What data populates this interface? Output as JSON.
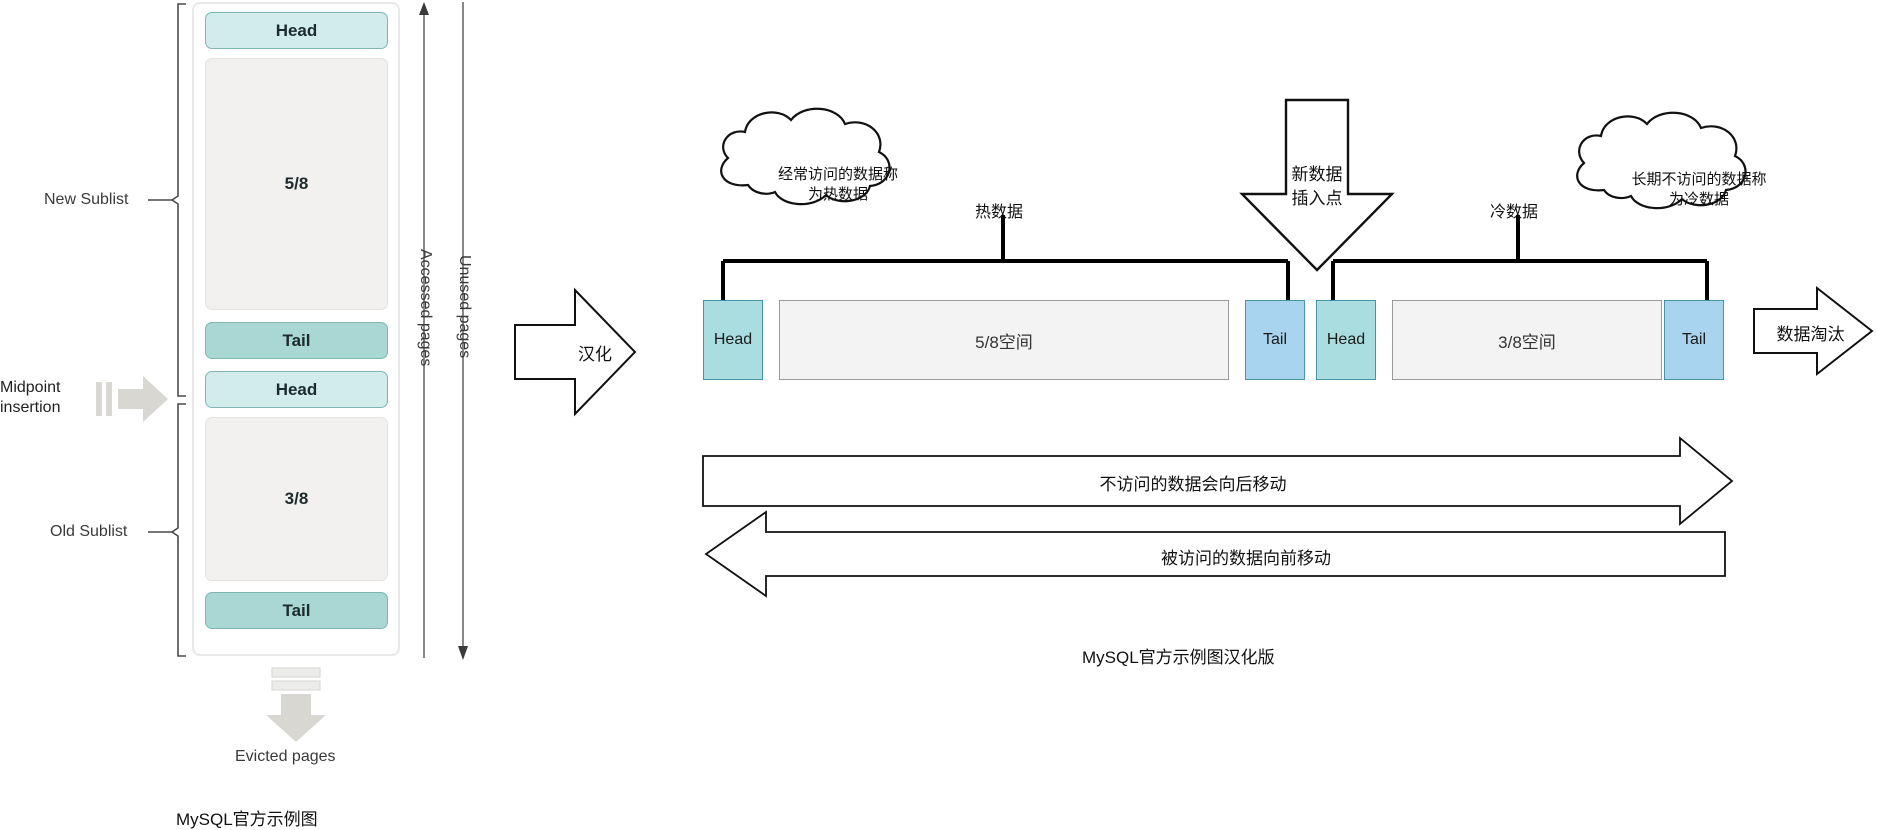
{
  "left_figure": {
    "title_caption": "MySQL官方示例图",
    "new_sublist_label": "New Sublist",
    "old_sublist_label": "Old Sublist",
    "midpoint_label_line1": "Midpoint",
    "midpoint_label_line2": "insertion",
    "accessed_pages_label": "Accessed pages",
    "unused_pages_label": "Unused pages",
    "evicted_pages_label": "Evicted pages",
    "blocks": [
      {
        "label": "Head",
        "kind": "head"
      },
      {
        "label": "5/8",
        "kind": "fraction"
      },
      {
        "label": "Tail",
        "kind": "tail"
      },
      {
        "label": "Head",
        "kind": "head"
      },
      {
        "label": "3/8",
        "kind": "fraction"
      },
      {
        "label": "Tail",
        "kind": "tail"
      }
    ],
    "colors": {
      "head_fill": "#d2ecec",
      "tail_fill": "#a9d8d4",
      "fraction_fill": "#f2f1ef",
      "panel_border": "#e8e8e8",
      "axis_stroke": "#6b6b6b",
      "big_arrow_fill": "#d9d7d2"
    }
  },
  "transition_arrow": {
    "label": "汉化"
  },
  "right_figure": {
    "caption": "MySQL官方示例图汉化版",
    "cloud_hot": "经常访问的数据称\n为热数据",
    "cloud_cold": "长期不访问的数据称\n为冷数据",
    "insert_arrow_line1": "新数据",
    "insert_arrow_line2": "插入点",
    "hot_data_label": "热数据",
    "cold_data_label": "冷数据",
    "evict_arrow_label": "数据淘汰",
    "backward_arrow_label": "不访问的数据会向后移动",
    "forward_arrow_label": "被访问的数据向前移动",
    "segments": [
      {
        "label": "Head",
        "kind": "head"
      },
      {
        "label": "5/8空间",
        "kind": "space"
      },
      {
        "label": "Tail",
        "kind": "tail"
      },
      {
        "label": "Head",
        "kind": "head"
      },
      {
        "label": "3/8空间",
        "kind": "space"
      },
      {
        "label": "Tail",
        "kind": "tail"
      }
    ],
    "colors": {
      "head_fill": "#a9dde0",
      "tail_fill": "#a8d4ef",
      "space_fill": "#f3f3f3",
      "space_border": "#9a9a9a",
      "connector_stroke": "#000000"
    }
  }
}
